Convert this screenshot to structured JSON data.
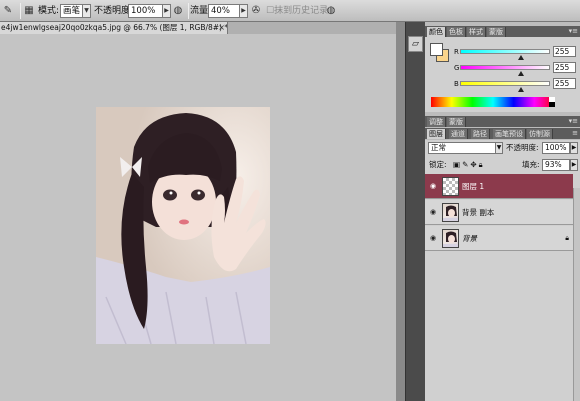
{
  "options_bar": {
    "mode_label": "模式:",
    "mode_value": "画笔",
    "opacity_label": "不透明度:",
    "opacity_value": "100%",
    "flow_label": "流量:",
    "flow_value": "40%",
    "erase_history_label": "抹到历史记录"
  },
  "document": {
    "tab_title": "e4jw1enwlgseaj20qo0zkqa5.jpg @ 66.7% (图层 1, RGB/8#) *",
    "close_glyph": "×"
  },
  "color_panel": {
    "tabs": [
      "颜色",
      "色板",
      "样式",
      "蒙版"
    ],
    "active_tab": 0,
    "foreground_color": "#ffffff",
    "background_color": "#fbd58c",
    "channels": [
      {
        "label": "R",
        "value": "255"
      },
      {
        "label": "G",
        "value": "255"
      },
      {
        "label": "B",
        "value": "255"
      }
    ]
  },
  "adjust_panel": {
    "tabs": [
      "调整",
      "蒙版"
    ]
  },
  "layers_panel": {
    "tabs": [
      "图层",
      "通道",
      "路径",
      "画笔预设",
      "仿制源"
    ],
    "blend_mode": "正常",
    "opacity_label": "不透明度:",
    "opacity_value": "100%",
    "lock_label": "锁定:",
    "fill_label": "填充:",
    "fill_value": "93%",
    "layers": [
      {
        "name": "图层 1",
        "selected": true,
        "thumb": "transparent",
        "italic": false,
        "locked": false
      },
      {
        "name": "背景 副本",
        "selected": false,
        "thumb": "image",
        "italic": false,
        "locked": false
      },
      {
        "name": "背景",
        "selected": false,
        "thumb": "image",
        "italic": true,
        "locked": true
      }
    ]
  },
  "colors": {
    "selected_layer": "#8c3a4c",
    "canvas_bg": "#c4c4c4"
  }
}
